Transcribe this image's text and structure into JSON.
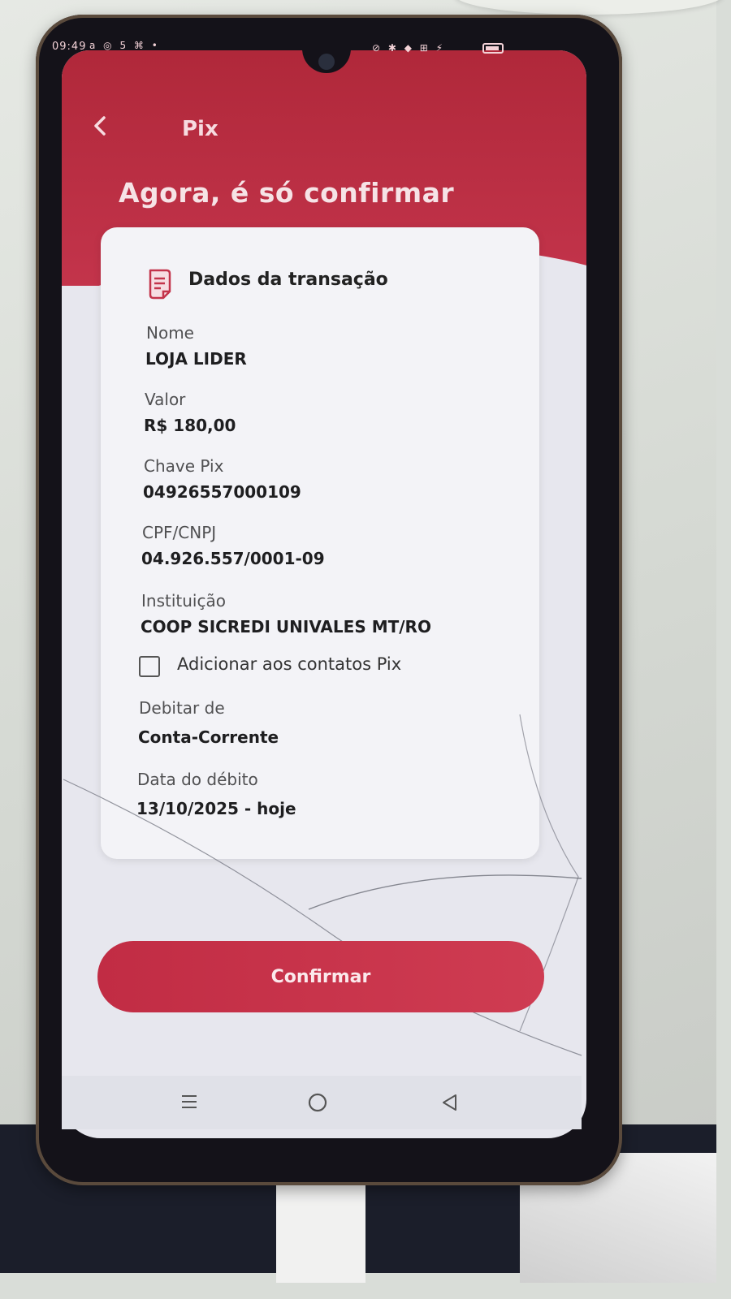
{
  "status_bar": {
    "time": "09:49",
    "indicators": "a ◎ 5 ⌘ •",
    "right_icons": "⊘ ✱ ◆ ⊞ ⚡"
  },
  "nav": {
    "title": "Pix",
    "back_icon": "chevron-left-icon"
  },
  "headline": "Agora, é só confirmar",
  "card": {
    "title": "Dados da transação",
    "icon": "document-icon",
    "fields": [
      {
        "label": "Nome",
        "value": "LOJA LIDER"
      },
      {
        "label": "Valor",
        "value": "R$ 180,00"
      },
      {
        "label": "Chave Pix",
        "value": "04926557000109"
      },
      {
        "label": "CPF/CNPJ",
        "value": "04.926.557/0001-09"
      },
      {
        "label": "Instituição",
        "value": "COOP SICREDI UNIVALES MT/RO"
      }
    ],
    "checkbox": {
      "label": "Adicionar aos contatos Pix",
      "checked": false
    },
    "debit": {
      "label": "Debitar de",
      "value": "Conta-Corrente"
    },
    "date": {
      "label": "Data do débito",
      "value": "13/10/2025 - hoje"
    }
  },
  "confirm_button": "Confirmar",
  "system_nav": {
    "icons": [
      "menu-icon",
      "home-icon",
      "back-icon"
    ]
  },
  "colors": {
    "brand_red": "#c3344b",
    "card_bg": "#f3f3f7"
  }
}
